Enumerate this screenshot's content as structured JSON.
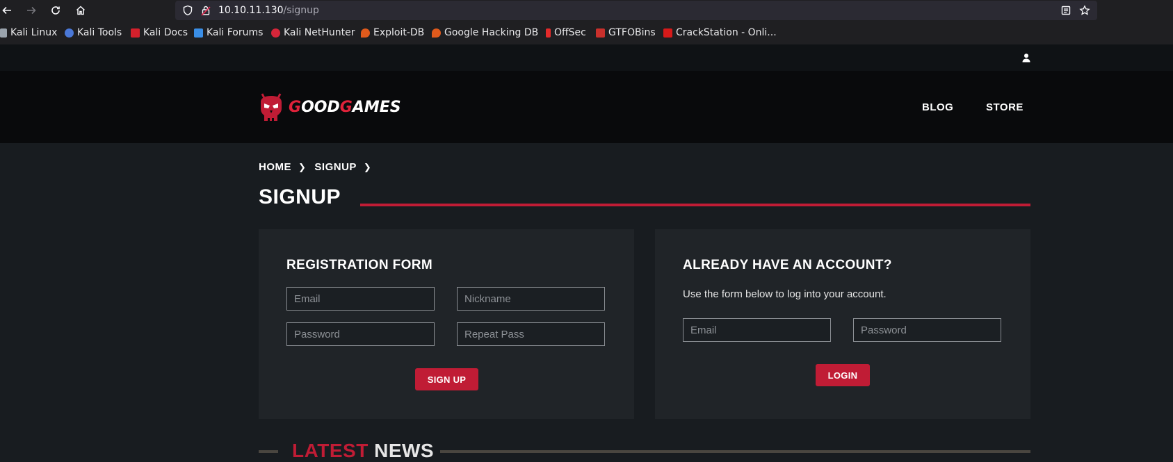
{
  "browser": {
    "url_host": "10.10.11.130",
    "url_path": "/signup",
    "bookmarks": [
      {
        "label": "Kali Linux",
        "icon": "kali-dragon-icon",
        "color": "#5b8fd6"
      },
      {
        "label": "Kali Tools",
        "icon": "kali-tools-icon",
        "color": "#4a78d8"
      },
      {
        "label": "Kali Docs",
        "icon": "kali-docs-icon",
        "color": "#d4202c"
      },
      {
        "label": "Kali Forums",
        "icon": "kali-forums-icon",
        "color": "#3a8ee6"
      },
      {
        "label": "Kali NetHunter",
        "icon": "nethunter-icon",
        "color": "#d6263a"
      },
      {
        "label": "Exploit-DB",
        "icon": "exploit-db-icon",
        "color": "#e05a1c"
      },
      {
        "label": "Google Hacking DB",
        "icon": "ghdb-icon",
        "color": "#e05a1c"
      },
      {
        "label": "OffSec",
        "icon": "offsec-icon",
        "color": "#e32a2a"
      },
      {
        "label": "GTFOBins",
        "icon": "gtfobins-icon",
        "color": "#c9302c"
      },
      {
        "label": "CrackStation - Onli...",
        "icon": "crackstation-icon",
        "color": "#d61a1a"
      }
    ]
  },
  "site": {
    "logo_part1": "G",
    "logo_part2": "OOD",
    "logo_part3": "G",
    "logo_part4": "AMES",
    "nav": [
      "BLOG",
      "STORE"
    ],
    "breadcrumb": [
      "HOME",
      "SIGNUP"
    ],
    "page_title": "SIGNUP",
    "accent_color": "#c01c35"
  },
  "registration": {
    "title": "REGISTRATION FORM",
    "email_placeholder": "Email",
    "nickname_placeholder": "Nickname",
    "password_placeholder": "Password",
    "repeat_placeholder": "Repeat Pass",
    "submit_label": "SIGN UP"
  },
  "login": {
    "title": "ALREADY HAVE AN ACCOUNT?",
    "description": "Use the form below to log into your account.",
    "email_placeholder": "Email",
    "password_placeholder": "Password",
    "submit_label": "LOGIN"
  },
  "news": {
    "title_accent": "LATEST",
    "title_rest": " NEWS"
  }
}
